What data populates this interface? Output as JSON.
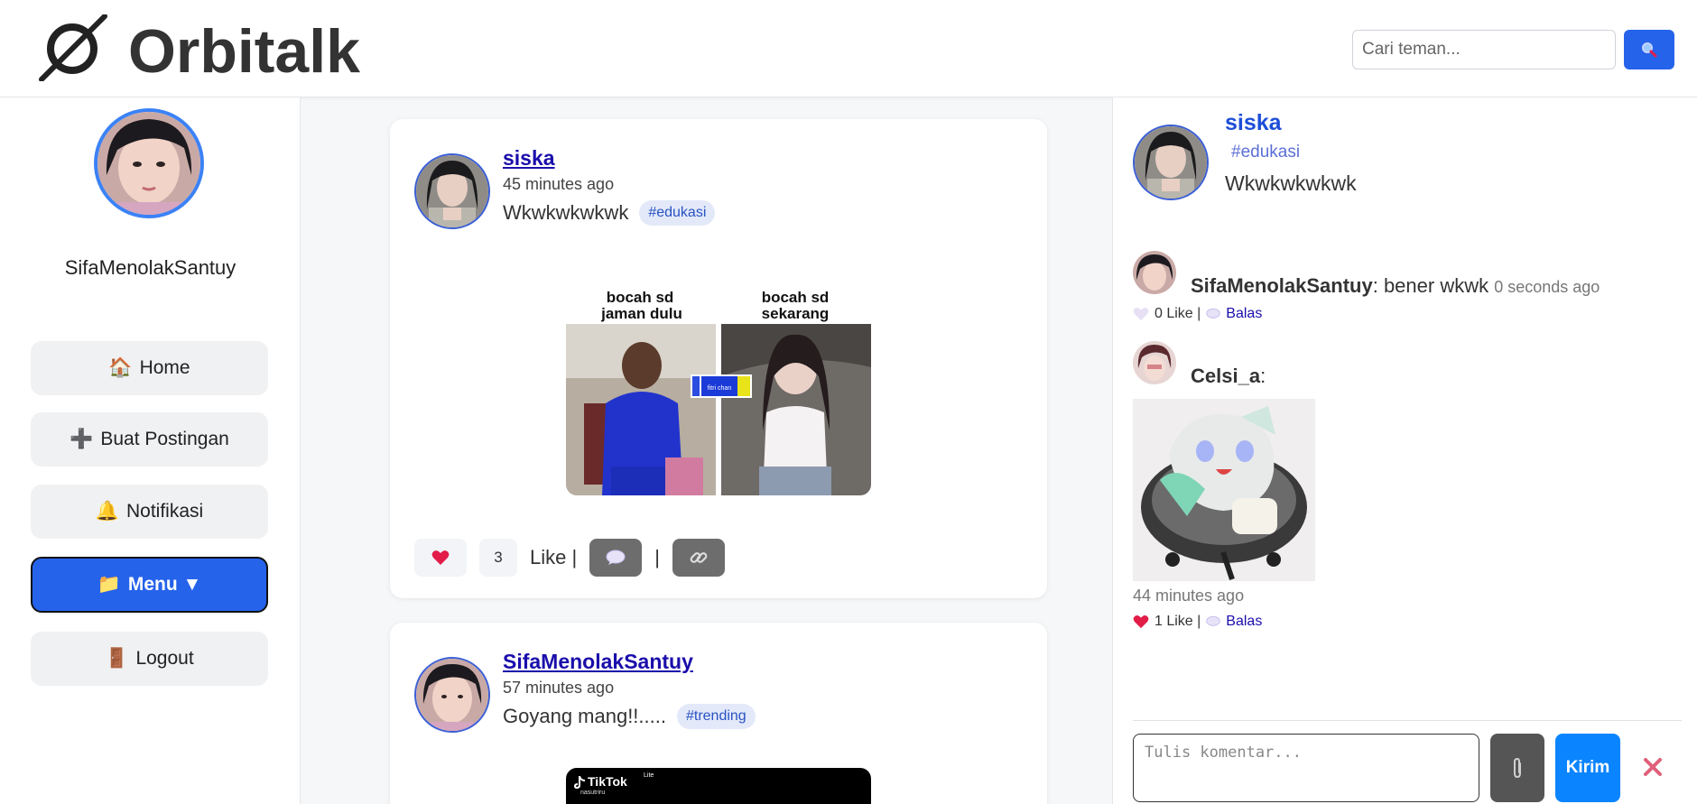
{
  "app": {
    "name": "Orbitalk"
  },
  "search": {
    "placeholder": "Cari teman...",
    "button_icon": "search-icon"
  },
  "sidebar": {
    "username": "SifaMenolakSantuy",
    "items": [
      {
        "icon": "🏠",
        "label": "Home"
      },
      {
        "icon": "➕",
        "label": "Buat Postingan"
      },
      {
        "icon": "🔔",
        "label": "Notifikasi"
      },
      {
        "icon": "📁",
        "label": "Menu ▼",
        "active": true
      },
      {
        "icon": "🚪",
        "label": "Logout"
      }
    ]
  },
  "feed": [
    {
      "user": "siska",
      "time": "45 minutes ago",
      "text": "Wkwkwkwkwk",
      "tag": "#edukasi",
      "image": {
        "left_caption": "bocah sd\njaman dulu",
        "right_caption": "bocah sd\nsekarang",
        "sticker": "fitri chan"
      },
      "like_count": "3",
      "like_label": "Like |",
      "separator": "|"
    },
    {
      "user": "SifaMenolakSantuy",
      "time": "57 minutes ago",
      "text": "Goyang mang!!.....",
      "tag": "#trending",
      "image": {
        "brand": "TikTok",
        "brand_sup": "Lite",
        "handle": "nasutriru"
      }
    }
  ],
  "panel": {
    "post": {
      "user": "siska",
      "tag": "#edukasi",
      "text": "Wkwkwkwkwk"
    },
    "comments": [
      {
        "user": "SifaMenolakSantuy",
        "text": ": bener wkwk",
        "time": "0 seconds ago",
        "likes": "0 Like |",
        "reply": "Balas",
        "liked": false
      },
      {
        "user": "Celsi_a",
        "text": ":",
        "image_time": "44 minutes ago",
        "likes": "1 Like |",
        "reply": "Balas",
        "liked": true
      }
    ],
    "input_placeholder": "Tulis komentar...",
    "send_label": "Kirim"
  },
  "colors": {
    "accent": "#2563eb",
    "send": "#0a84ff",
    "like": "#e11d48",
    "tag_bg": "#e3e9f9"
  }
}
